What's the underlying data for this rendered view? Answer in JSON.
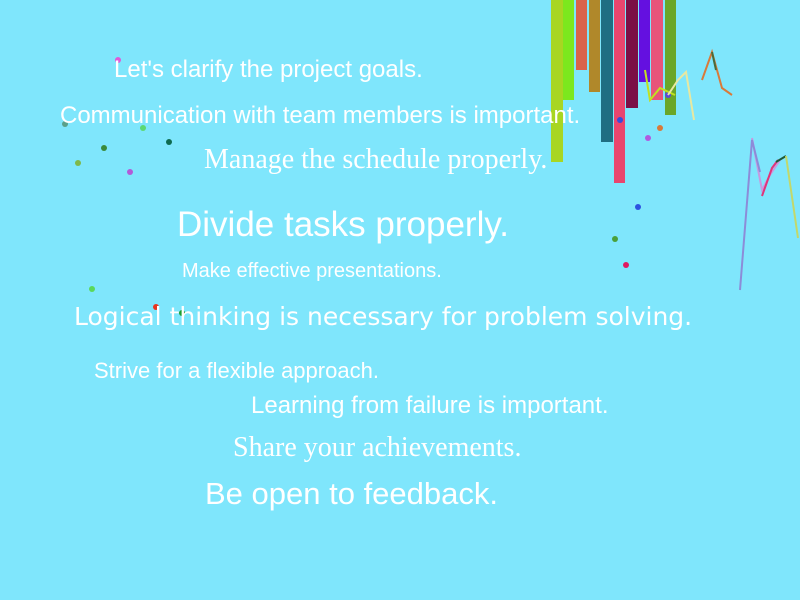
{
  "background": "#7fe6fc",
  "text_color": "#ffffff",
  "messages": [
    "Let's clarify the project goals.",
    "Communication with team members is important.",
    "Manage the schedule properly.",
    "Divide tasks properly.",
    "Make effective presentations.",
    "Logical thinking is necessary for problem solving.",
    "Strive for a flexible approach.",
    "Learning from failure is important.",
    "Share your achievements.",
    "Be open to feedback."
  ],
  "bar_colors": [
    "#a8d622",
    "#7ce81e",
    "#d9634a",
    "#b0882a",
    "#1f6e82",
    "#e9456e",
    "#7b0f46",
    "#8a46e8",
    "#e8547a",
    "#6410e0",
    "#6aa628"
  ],
  "dot_colors": [
    "#e05ad8",
    "#5aa08a",
    "#5cd872",
    "#3a8a3a",
    "#0e6b50",
    "#b25ad8",
    "#7fb84a",
    "#2d52e0",
    "#4aa03a",
    "#e01860",
    "#5ad85a",
    "#e8351e",
    "#1c9e2e",
    "#3a4ad8",
    "#d87a3a",
    "#b05ae0",
    "#5a4ad8"
  ],
  "line_colors": [
    "#c2e01e",
    "#e8e8a0",
    "#d87a3a",
    "#4a6a3a",
    "#c89ae0",
    "#8c8cd8",
    "#e0347a",
    "#1c5a3a",
    "#c2d86a"
  ]
}
